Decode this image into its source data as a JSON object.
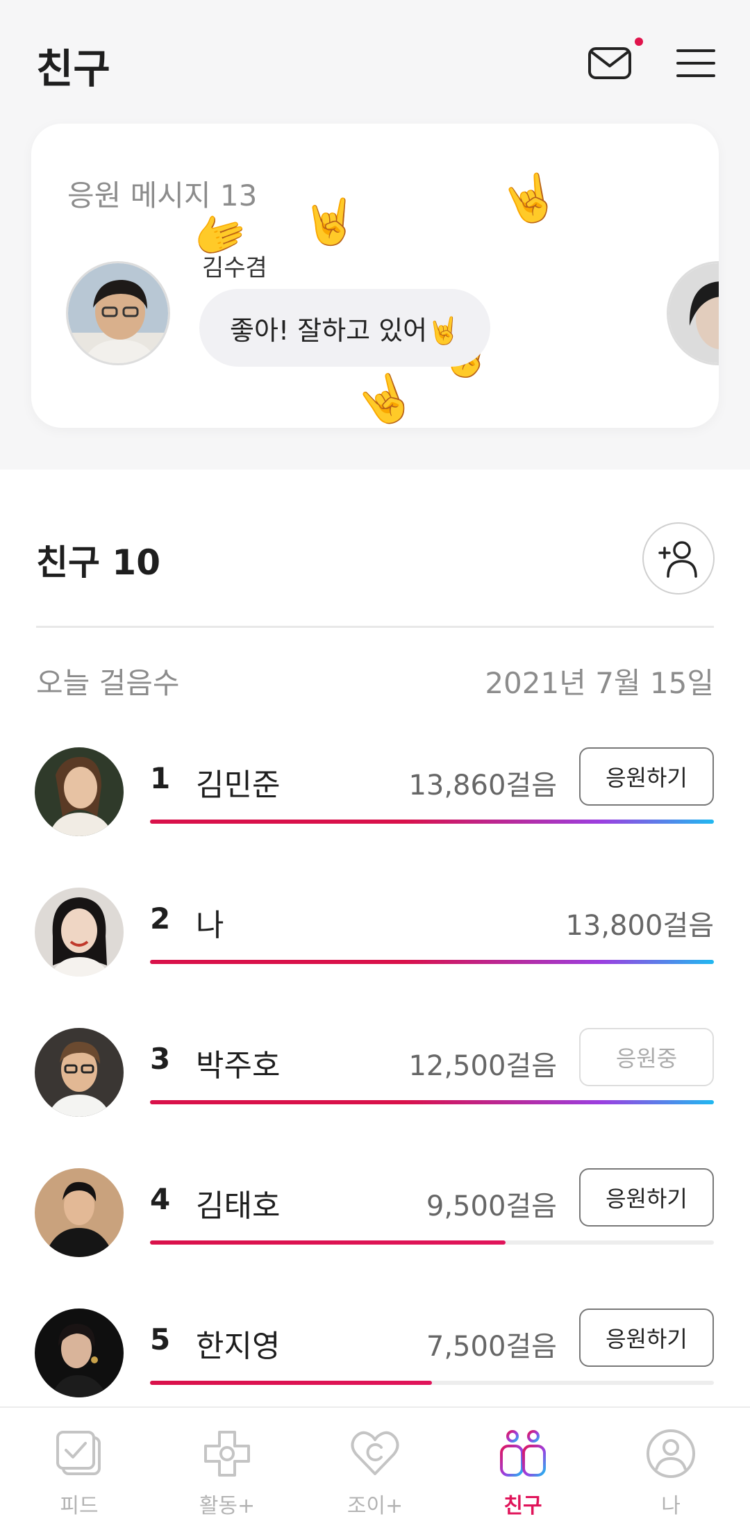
{
  "header": {
    "title": "친구"
  },
  "cheer": {
    "title": "응원 메시지 13",
    "sender": "김수겸",
    "message": "좋아! 잘하고 있어🤘"
  },
  "friends": {
    "title": "친구 10",
    "today_label": "오늘 걸음수",
    "date": "2021년 7월 15일",
    "rows": [
      {
        "rank": "1",
        "name": "김민준",
        "steps": "13,860걸음",
        "button": "응원하기",
        "progress": 1.0
      },
      {
        "rank": "2",
        "name": "나",
        "steps": "13,800걸음",
        "button": "",
        "progress": 1.0
      },
      {
        "rank": "3",
        "name": "박주호",
        "steps": "12,500걸음",
        "button": "응원중",
        "progress": 1.0
      },
      {
        "rank": "4",
        "name": "김태호",
        "steps": "9,500걸음",
        "button": "응원하기",
        "progress": 0.63
      },
      {
        "rank": "5",
        "name": "한지영",
        "steps": "7,500걸음",
        "button": "응원하기",
        "progress": 0.5
      }
    ]
  },
  "tabs": [
    {
      "label": "피드",
      "icon": "feed-check-icon"
    },
    {
      "label": "활동+",
      "icon": "activity-cross-icon"
    },
    {
      "label": "조이+",
      "icon": "joy-heart-icon"
    },
    {
      "label": "친구",
      "icon": "friends-icon",
      "active": true
    },
    {
      "label": "나",
      "icon": "profile-icon"
    }
  ],
  "colors": {
    "accent": "#e0145a",
    "gradient_start": "#d9114a",
    "gradient_mid": "#9b3fe0",
    "gradient_end": "#20b8f0"
  }
}
